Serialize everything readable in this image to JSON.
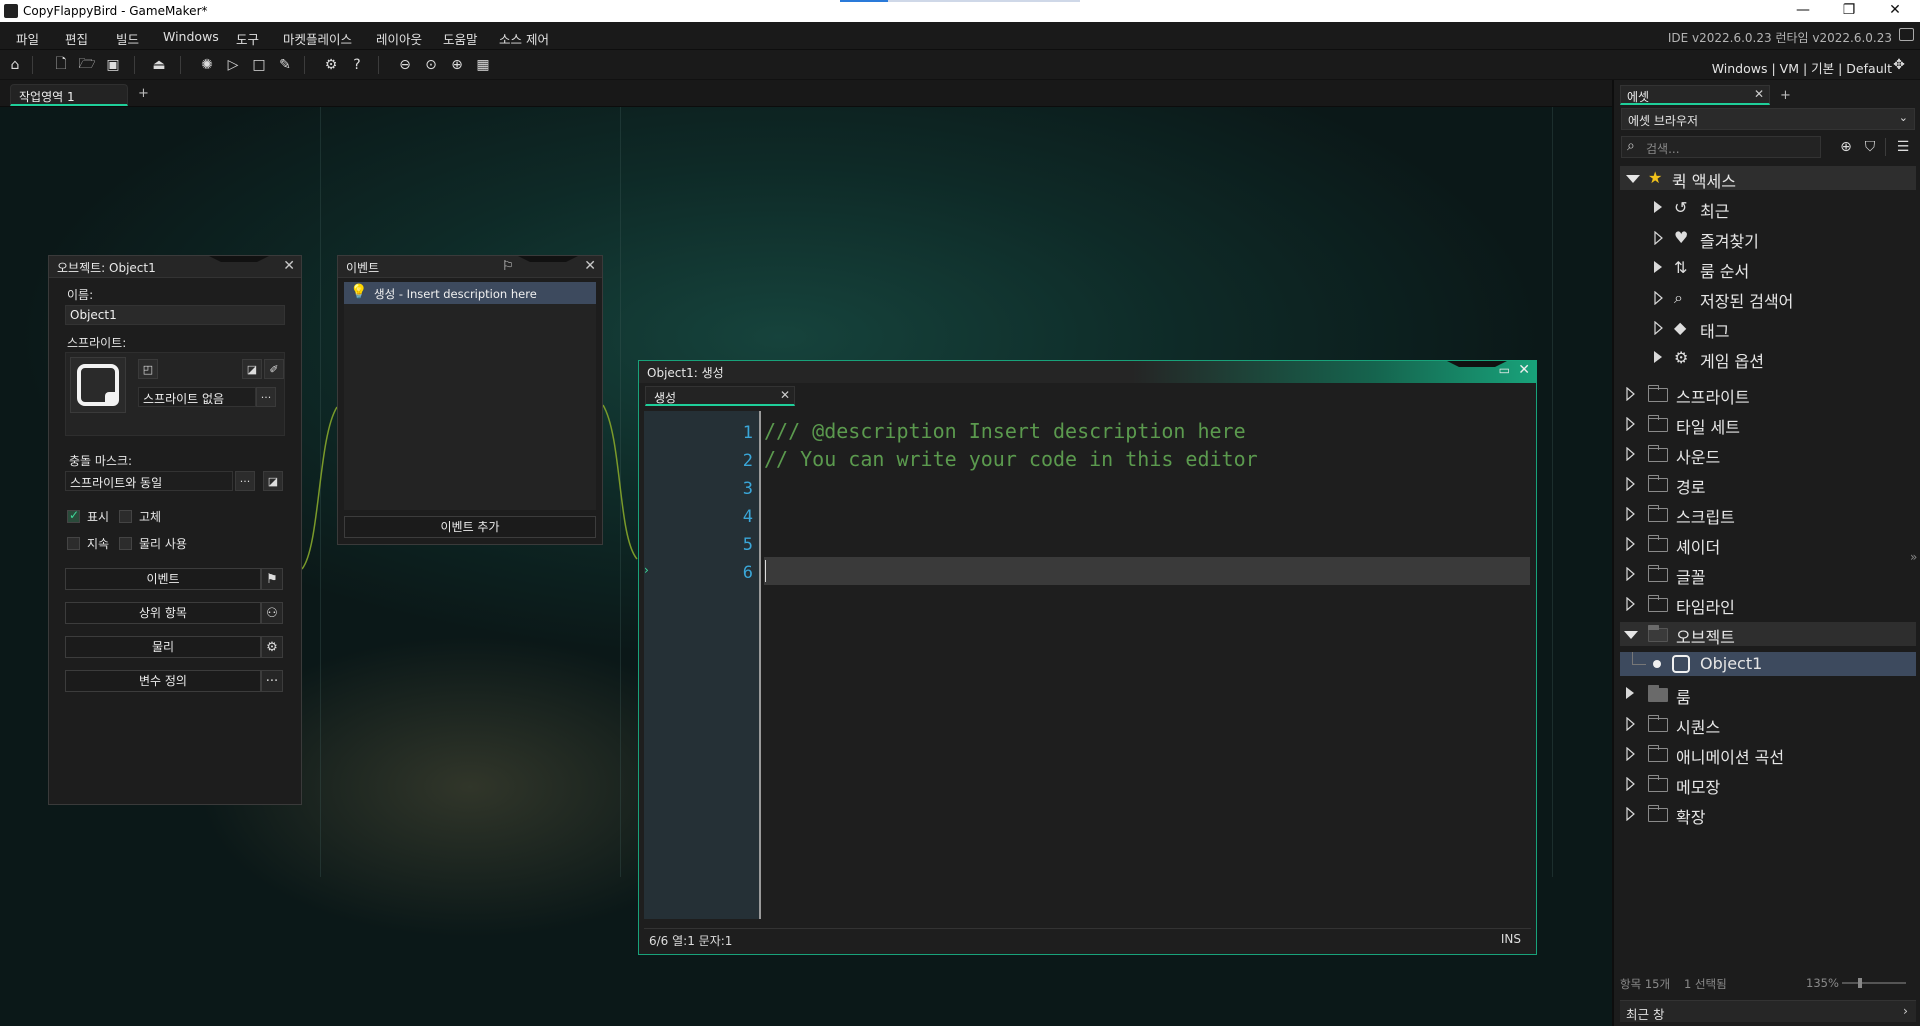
{
  "window": {
    "title": "CopyFlappyBird - GameMaker*",
    "min": "—",
    "max": "❐",
    "close": "✕"
  },
  "menubar": {
    "items": [
      "파일",
      "편집",
      "빌드",
      "Windows",
      "도구",
      "마켓플레이스",
      "레이아웃",
      "도움말",
      "소스 제어"
    ],
    "version": "IDE v2022.6.0.23 런타임 v2022.6.0.23"
  },
  "toolbar": {
    "target": "Windows | VM | 기본 | Default"
  },
  "workspace": {
    "tab_label": "작업영역 1",
    "add_tab": "+"
  },
  "object_panel": {
    "title": "오브젝트: Object1",
    "name_label": "이름:",
    "name_value": "Object1",
    "sprite_label": "스프라이트:",
    "sprite_value": "스프라이트 없음",
    "more": "···",
    "mask_label": "충돌 마스크:",
    "mask_value": "스프라이트와 동일",
    "visible_label": "표시",
    "visible": true,
    "solid_label": "고체",
    "solid": false,
    "persistent_label": "지속",
    "persistent": false,
    "physics_label": "물리 사용",
    "physics": false,
    "events_btn": "이벤트",
    "parent_btn": "상위 항목",
    "physics_btn": "물리",
    "vars_btn": "변수 정의"
  },
  "events_panel": {
    "title": "이벤트",
    "items": [
      "생성 - Insert description here"
    ],
    "add_btn": "이벤트 추가"
  },
  "code_editor": {
    "title": "Object1: 생성",
    "tab": "생성",
    "line_numbers": [
      "1",
      "2",
      "3",
      "4",
      "5",
      "6"
    ],
    "lines": [
      "/// @description Insert description here",
      "// You can write your code in this editor",
      "",
      "",
      "",
      ""
    ],
    "status": "6/6 열:1 문자:1",
    "mode": "INS"
  },
  "asset_panel": {
    "tab": "에셋",
    "dropdown": "에셋 브라우저",
    "search_placeholder": "검색...",
    "quick_access": "퀵 액세스",
    "quick_items": [
      {
        "label": "최근",
        "icon": "history-icon"
      },
      {
        "label": "즐겨찾기",
        "icon": "heart-icon"
      },
      {
        "label": "룸 순서",
        "icon": "sort-icon"
      },
      {
        "label": "저장된 검색어",
        "icon": "search-icon"
      },
      {
        "label": "태그",
        "icon": "tag-icon"
      },
      {
        "label": "게임 옵션",
        "icon": "gear-icon"
      }
    ],
    "folders": [
      "스프라이트",
      "타일 세트",
      "사운드",
      "경로",
      "스크립트",
      "셰이더",
      "글꼴",
      "타임라인",
      "오브젝트",
      "룸",
      "시퀀스",
      "애니메이션 곡선",
      "메모장",
      "확장"
    ],
    "object_item": "Object1",
    "status_count": "항목 15개",
    "status_selected": "1 선택됨",
    "zoom": "135%",
    "recent_window": "최근 창"
  },
  "colors": {
    "accent": "#1fcf9a",
    "line_number": "#3aa6d8",
    "comment": "#5b9a4e"
  }
}
